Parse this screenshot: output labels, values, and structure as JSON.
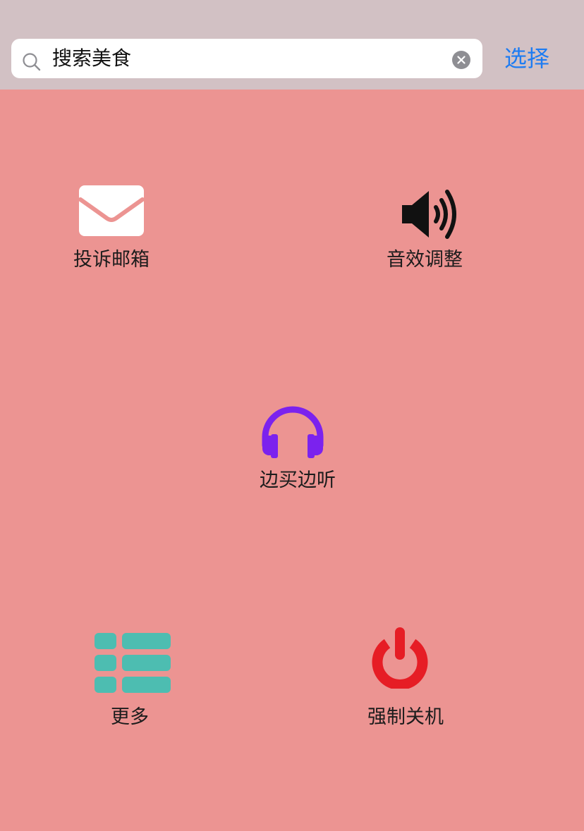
{
  "search": {
    "value": "搜索美食",
    "select_label": "选择"
  },
  "menu": {
    "items": [
      {
        "label": "投诉邮箱",
        "icon": "mail-icon",
        "color": "#ffffff"
      },
      {
        "label": "音效调整",
        "icon": "speaker-icon",
        "color": "#111111"
      },
      {
        "label": "边买边听",
        "icon": "headphones-icon",
        "color": "#7b22ee"
      },
      {
        "label": "更多",
        "icon": "list-icon",
        "color": "#4dbdb1"
      },
      {
        "label": "强制关机",
        "icon": "power-icon",
        "color": "#e61d25"
      }
    ]
  },
  "colors": {
    "background": "#ec9492",
    "header": "#d2c1c4",
    "accent": "#1e7cf2"
  }
}
